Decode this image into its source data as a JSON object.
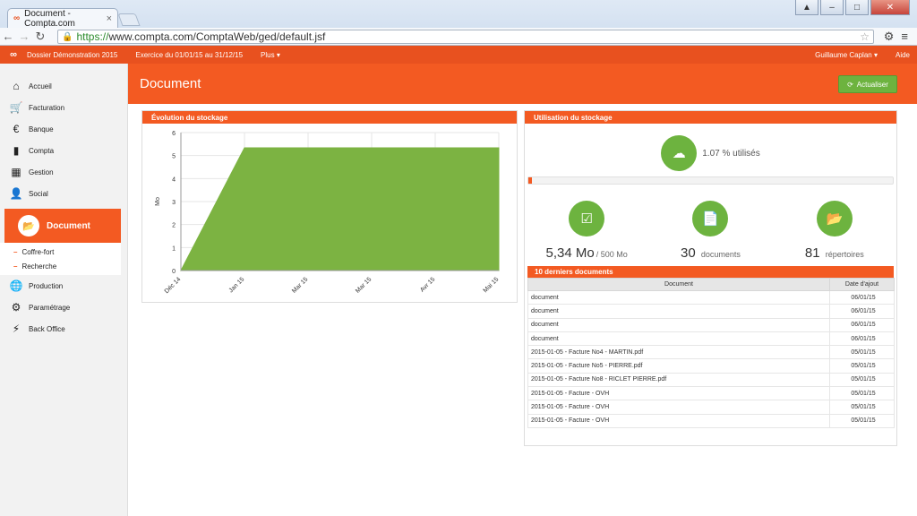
{
  "browser": {
    "tab_title": "Document - Compta.com",
    "url_scheme": "https://",
    "url_rest": "www.compta.com/ComptaWeb/ged/default.jsf"
  },
  "appbar": {
    "dossier": "Dossier Démonstration 2015",
    "exercice": "Exercice du 01/01/15 au 31/12/15",
    "plus": "Plus",
    "user": "Guillaume Caplan",
    "aide": "Aide"
  },
  "sidebar": {
    "items_top": [
      "Accueil",
      "Facturation",
      "Banque",
      "Compta",
      "Gestion",
      "Social"
    ],
    "active": "Document",
    "sub": [
      "Coffre-fort",
      "Recherche"
    ],
    "items_bottom": [
      "Production",
      "Paramétrage",
      "Back Office"
    ]
  },
  "page": {
    "title": "Document",
    "refresh_label": "Actualiser"
  },
  "storage_panel": {
    "title": "Évolution du stockage"
  },
  "usage_panel": {
    "title": "Utilisation du stockage",
    "percent_text": "1.07 % utilisés",
    "percent_value": 1.07,
    "size_value": "5,34 Mo",
    "size_total": "/ 500 Mo",
    "docs_count": "30",
    "docs_label": "documents",
    "dirs_count": "81",
    "dirs_label": "répertoires"
  },
  "documents": {
    "title": "10 derniers documents",
    "headers": [
      "Document",
      "Date d'ajout"
    ],
    "rows": [
      [
        "document",
        "06/01/15"
      ],
      [
        "document",
        "06/01/15"
      ],
      [
        "document",
        "06/01/15"
      ],
      [
        "document",
        "06/01/15"
      ],
      [
        "2015-01-05 - Facture No4 - MARTIN.pdf",
        "05/01/15"
      ],
      [
        "2015-01-05 - Facture No5 - PIERRE.pdf",
        "05/01/15"
      ],
      [
        "2015-01-05 - Facture No8 - RICLET PIERRE.pdf",
        "05/01/15"
      ],
      [
        "2015-01-05 - Facture - OVH",
        "05/01/15"
      ],
      [
        "2015-01-05 - Facture - OVH",
        "05/01/15"
      ],
      [
        "2015-01-05 - Facture - OVH",
        "05/01/15"
      ]
    ]
  },
  "chart_data": {
    "type": "area",
    "categories": [
      "Déc 14",
      "Jan 15",
      "Mar 15",
      "Mar 15",
      "Avr 15",
      "Mai 15"
    ],
    "values": [
      0,
      5.34,
      5.34,
      5.34,
      5.34,
      5.34
    ],
    "ylabel": "Mo",
    "ylim": [
      0,
      6
    ],
    "yticks": [
      0,
      1,
      2,
      3,
      4,
      5,
      6
    ],
    "color": "#7cb342",
    "grid": true
  },
  "colors": {
    "accent": "#f35a22",
    "green": "#6db33f"
  }
}
